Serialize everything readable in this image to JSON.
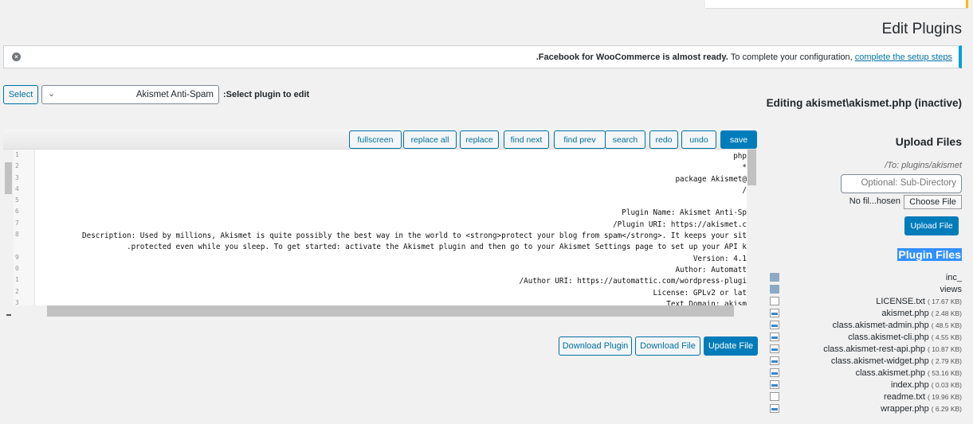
{
  "page_title": "Edit Plugins",
  "notice": {
    "bold": ".Facebook for WooCommerce is almost ready.",
    "text": "To complete your configuration,",
    "link": "complete the setup steps",
    "dismiss_icon": "dismiss-icon"
  },
  "plugin_select": {
    "button": "Select",
    "value": "Akismet Anti-Spam",
    "label": ":Select plugin to edit"
  },
  "editing": "Editing akismet\\akismet.php (inactive)",
  "toolbar": [
    "fullscreen",
    "replace all",
    "replace",
    "find next",
    "find prev",
    "search",
    "redo",
    "undo",
    "save"
  ],
  "gutter": [
    "1",
    "2",
    "3",
    "4",
    "5",
    "6",
    "7",
    "8",
    "",
    "9",
    "0",
    "1",
    "2",
    "3"
  ],
  "code_lines": [
    "php",
    "*",
    "package Akismet@",
    "/",
    "",
    "Plugin Name: Akismet Anti-Sp",
    "/Plugin URI: https://akismet.c",
    "Description: Used by millions, Akismet is quite possibly the best way in the world to <strong>protect your blog from spam</strong>. It keeps your sit",
    ".protected even while you sleep. To get started: activate the Akismet plugin and then go to your Akismet Settings page to set up your API k",
    "Version: 4.1",
    "Author: Automatt",
    "/Author URI: https://automattic.com/wordpress-plugi",
    "License: GPLv2 or lat",
    "Text Domain: akism"
  ],
  "actions": {
    "download_plugin": "Download Plugin",
    "download_file": "Download File",
    "update_file": "Update File"
  },
  "upload": {
    "title": "Upload Files",
    "to": "/To: plugins/akismet",
    "subdir_placeholder": "Optional: Sub-Directory",
    "no_file": "No fil...hosen",
    "choose": "Choose File",
    "button": "Upload File"
  },
  "plugin_files": {
    "title": "Plugin Files",
    "items": [
      {
        "name": "inc_",
        "type": "folder",
        "size": ""
      },
      {
        "name": "views",
        "type": "folder",
        "size": ""
      },
      {
        "name": "LICENSE.txt",
        "type": "txt",
        "size": "( 17.67 KB)"
      },
      {
        "name": "akismet.php",
        "type": "php",
        "size": "( 2.48 KB)"
      },
      {
        "name": "class.akismet-admin.php",
        "type": "php",
        "size": "( 48.5 KB)"
      },
      {
        "name": "class.akismet-cli.php",
        "type": "php",
        "size": "( 4.55 KB)"
      },
      {
        "name": "class.akismet-rest-api.php",
        "type": "php",
        "size": "( 10.87 KB)"
      },
      {
        "name": "class.akismet-widget.php",
        "type": "php",
        "size": "( 2.79 KB)"
      },
      {
        "name": "class.akismet.php",
        "type": "php",
        "size": "( 53.16 KB)"
      },
      {
        "name": "index.php",
        "type": "php",
        "size": "( 0.03 KB)"
      },
      {
        "name": "readme.txt",
        "type": "txt",
        "size": "( 19.96 KB)"
      },
      {
        "name": "wrapper.php",
        "type": "php",
        "size": "( 6.29 KB)"
      }
    ]
  },
  "colors": {
    "accent": "#007cba",
    "notice_border": "#00a0d2",
    "selection": "#3390ff"
  }
}
